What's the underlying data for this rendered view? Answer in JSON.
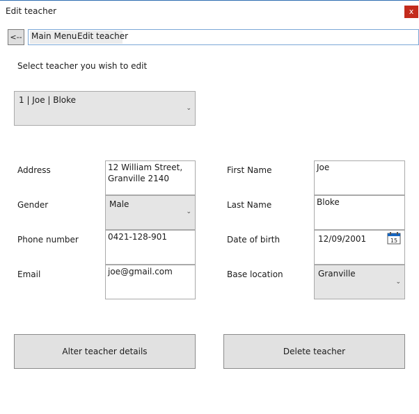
{
  "window": {
    "title": "Edit teacher",
    "close_label": "x"
  },
  "nav": {
    "back_label": "<--",
    "breadcrumb": [
      "Main Menu",
      "Edit teacher"
    ]
  },
  "select_prompt": "Select teacher you wish to edit",
  "teacher_select": {
    "value": "1 | Joe | Bloke"
  },
  "form": {
    "address_label": "Address",
    "address_value": "12 William Street,\nGranville 2140",
    "gender_label": "Gender",
    "gender_value": "Male",
    "phone_label": "Phone number",
    "phone_value": "0421-128-901",
    "email_label": "Email",
    "email_value": "joe@gmail.com",
    "first_name_label": "First Name",
    "first_name_value": "Joe",
    "last_name_label": "Last Name",
    "last_name_value": "Bloke",
    "dob_label": "Date of birth",
    "dob_value": "12/09/2001",
    "dob_calendar_day": "15",
    "base_location_label": "Base location",
    "base_location_value": "Granville"
  },
  "actions": {
    "alter_label": "Alter teacher details",
    "delete_label": "Delete teacher"
  },
  "colors": {
    "close_bg": "#c42b1c",
    "breadcrumb_border": "#7aa7d6",
    "calendar_blue": "#1565c0"
  }
}
